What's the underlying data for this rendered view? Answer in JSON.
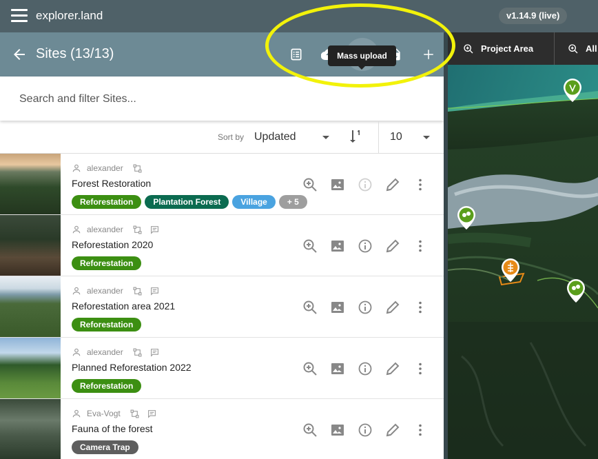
{
  "app": {
    "title": "explorer.land",
    "version": "v1.14.9 (live)"
  },
  "panel": {
    "title": "Sites (13/13)",
    "tooltip": "Mass upload"
  },
  "search": {
    "placeholder": "Search and filter Sites..."
  },
  "sort": {
    "label": "Sort by",
    "value": "Updated",
    "page_size": "10"
  },
  "map": {
    "btn_project": "Project Area",
    "btn_all": "All"
  },
  "rows": [
    {
      "user": "alexander",
      "name": "Forest Restoration",
      "tags": [
        {
          "label": "Reforestation",
          "color": "#3c8f12"
        },
        {
          "label": "Plantation Forest",
          "color": "#0b6b50"
        },
        {
          "label": "Village",
          "color": "#4aa3e0"
        },
        {
          "label": "+ 5",
          "color": "#9e9e9e"
        }
      ]
    },
    {
      "user": "alexander",
      "name": "Reforestation 2020",
      "tags": [
        {
          "label": "Reforestation",
          "color": "#3c8f12"
        }
      ]
    },
    {
      "user": "alexander",
      "name": "Reforestation area 2021",
      "tags": [
        {
          "label": "Reforestation",
          "color": "#3c8f12"
        }
      ]
    },
    {
      "user": "alexander",
      "name": "Planned Reforestation 2022",
      "tags": [
        {
          "label": "Reforestation",
          "color": "#3c8f12"
        }
      ]
    },
    {
      "user": "Eva-Vogt",
      "name": "Fauna of the forest",
      "tags": [
        {
          "label": "Camera Trap",
          "color": "#5e5e5e"
        }
      ]
    }
  ],
  "colors": {
    "topbar": "#4f6168",
    "panel_header": "#6d8a95",
    "highlight": "#f2f20a"
  },
  "icons": [
    "menu-icon",
    "arrow-left-icon",
    "checklist-icon",
    "cloud-upload-icon",
    "file-upload-icon",
    "file-download-icon",
    "plus-icon",
    "sort-numeric-icon",
    "person-icon",
    "shape-icon",
    "comment-icon",
    "zoom-in-icon",
    "image-icon",
    "info-icon",
    "pencil-icon",
    "more-vert-icon",
    "map-pin-icon"
  ]
}
